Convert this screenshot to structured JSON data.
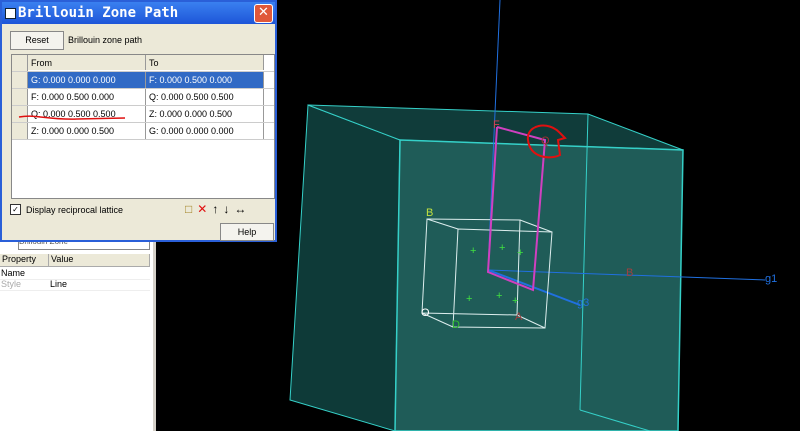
{
  "dialog": {
    "title": "Brillouin Zone Path",
    "reset_label": "Reset",
    "path_label": "Brillouin zone path",
    "columns": [
      "From",
      "To"
    ],
    "rows": [
      {
        "from": "G:  0.000  0.000  0.000",
        "to": "F:  0.000  0.500  0.000"
      },
      {
        "from": "F:  0.000  0.500  0.000",
        "to": "Q:  0.000  0.500  0.500"
      },
      {
        "from": "Q:  0.000  0.500  0.500",
        "to": "Z:  0.000  0.000  0.500"
      },
      {
        "from": "Z:  0.000  0.000  0.500",
        "to": "G:  0.000  0.000  0.000"
      }
    ],
    "selected_row": 0,
    "display_lattice_label": "Display reciprocal lattice",
    "display_lattice_checked": true,
    "help_label": "Help"
  },
  "properties": {
    "combo_value": "Brillouin Zone",
    "columns": [
      "Property",
      "Value"
    ],
    "rows": [
      {
        "property": "Name",
        "value": ""
      },
      {
        "property": "Style",
        "value": "Line"
      }
    ]
  },
  "scene": {
    "labels": {
      "F": "F",
      "Q": "Q",
      "B": "B",
      "O": "O",
      "D": "D",
      "A": "A",
      "g1": "g1",
      "g3": "g3",
      "B2": "B"
    }
  },
  "colors": {
    "box": "#35d0c8",
    "path": "#d040c0",
    "axis": "#2070e0",
    "annotation": "#e01010"
  }
}
